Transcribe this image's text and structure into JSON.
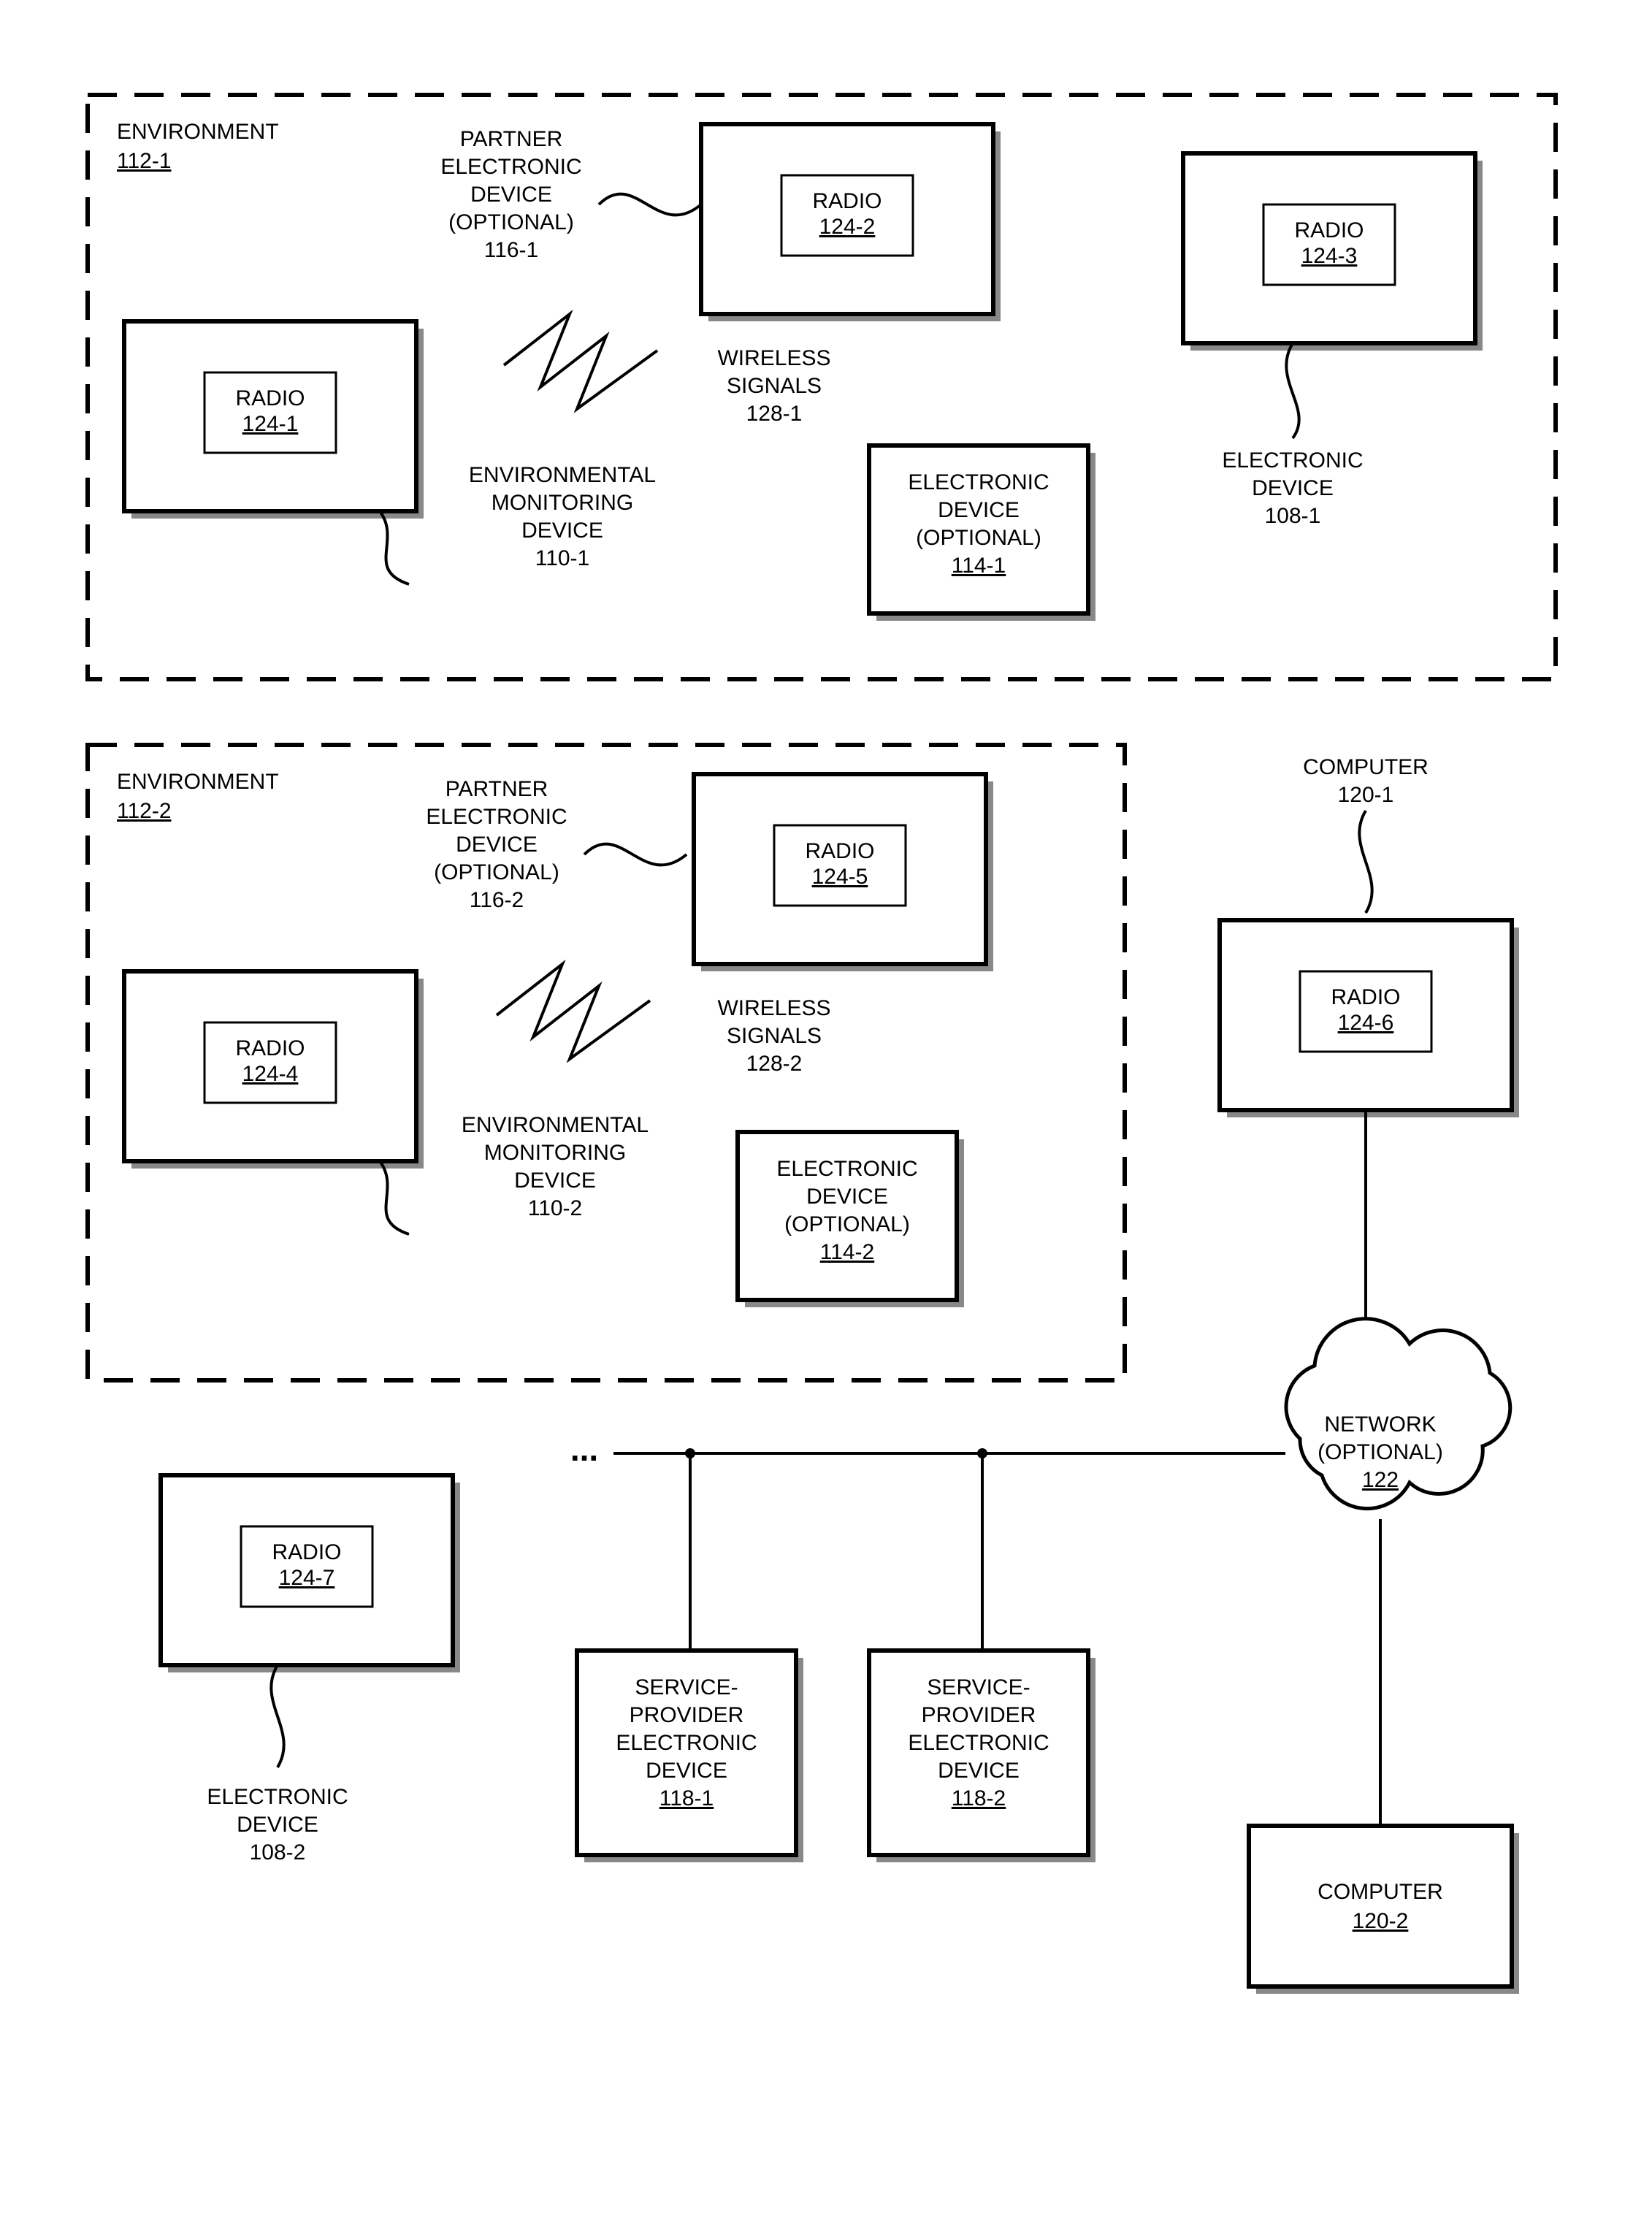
{
  "env1": {
    "title": "ENVIRONMENT",
    "ref": "112-1"
  },
  "env2": {
    "title": "ENVIRONMENT",
    "ref": "112-2"
  },
  "radio": {
    "r1": {
      "label": "RADIO",
      "ref": "124-1"
    },
    "r2": {
      "label": "RADIO",
      "ref": "124-2"
    },
    "r3": {
      "label": "RADIO",
      "ref": "124-3"
    },
    "r4": {
      "label": "RADIO",
      "ref": "124-4"
    },
    "r5": {
      "label": "RADIO",
      "ref": "124-5"
    },
    "r6": {
      "label": "RADIO",
      "ref": "124-6"
    },
    "r7": {
      "label": "RADIO",
      "ref": "124-7"
    }
  },
  "partner1": {
    "l1": "PARTNER",
    "l2": "ELECTRONIC",
    "l3": "DEVICE",
    "l4": "(OPTIONAL)",
    "ref": "116-1"
  },
  "partner2": {
    "l1": "PARTNER",
    "l2": "ELECTRONIC",
    "l3": "DEVICE",
    "l4": "(OPTIONAL)",
    "ref": "116-2"
  },
  "wsig1": {
    "l1": "WIRELESS",
    "l2": "SIGNALS",
    "ref": "128-1"
  },
  "wsig2": {
    "l1": "WIRELESS",
    "l2": "SIGNALS",
    "ref": "128-2"
  },
  "emd1": {
    "l1": "ENVIRONMENTAL",
    "l2": "MONITORING",
    "l3": "DEVICE",
    "ref": "110-1"
  },
  "emd2": {
    "l1": "ENVIRONMENTAL",
    "l2": "MONITORING",
    "l3": "DEVICE",
    "ref": "110-2"
  },
  "edopt1": {
    "l1": "ELECTRONIC",
    "l2": "DEVICE",
    "l3": "(OPTIONAL)",
    "ref": "114-1"
  },
  "edopt2": {
    "l1": "ELECTRONIC",
    "l2": "DEVICE",
    "l3": "(OPTIONAL)",
    "ref": "114-2"
  },
  "ed1": {
    "l1": "ELECTRONIC",
    "l2": "DEVICE",
    "ref": "108-1"
  },
  "ed2": {
    "l1": "ELECTRONIC",
    "l2": "DEVICE",
    "ref": "108-2"
  },
  "comp120_1": {
    "l1": "COMPUTER",
    "ref": "120-1"
  },
  "comp120_2": {
    "label": "COMPUTER",
    "ref": "120-2"
  },
  "net": {
    "l1": "NETWORK",
    "l2": "(OPTIONAL)",
    "ref": "122"
  },
  "sp1": {
    "l1": "SERVICE-",
    "l2": "PROVIDER",
    "l3": "ELECTRONIC",
    "l4": "DEVICE",
    "ref": "118-1"
  },
  "sp2": {
    "l1": "SERVICE-",
    "l2": "PROVIDER",
    "l3": "ELECTRONIC",
    "l4": "DEVICE",
    "ref": "118-2"
  },
  "ellipsis": "..."
}
